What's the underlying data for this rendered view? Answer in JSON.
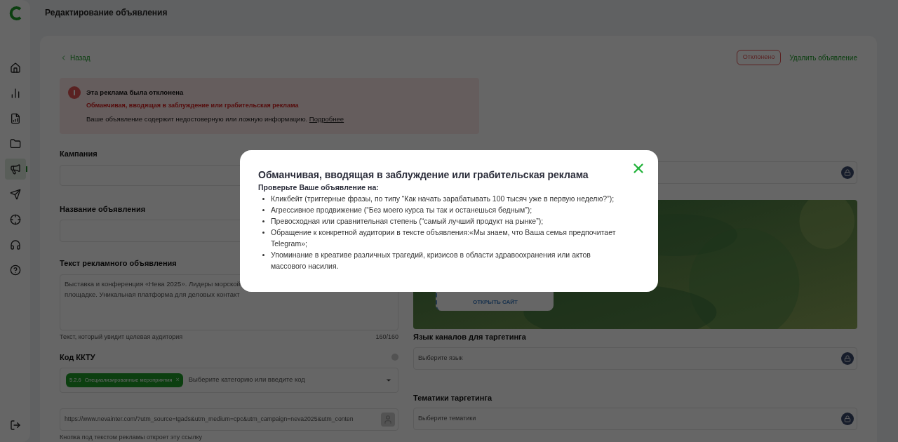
{
  "header": {
    "title": "Редактирование объявления"
  },
  "sidebar": {
    "items": [
      {
        "kind": "home",
        "selected": false
      },
      {
        "kind": "stats",
        "selected": false
      },
      {
        "kind": "report",
        "selected": false
      },
      {
        "kind": "folder",
        "selected": false
      },
      {
        "kind": "ads",
        "selected": true
      },
      {
        "kind": "send",
        "selected": false
      },
      {
        "kind": "target",
        "selected": false
      },
      {
        "kind": "support",
        "selected": false
      },
      {
        "kind": "help",
        "selected": false
      }
    ]
  },
  "back_link": "Назад",
  "status_badge": "Отклонено",
  "delete_link": "Удалить объявление",
  "alert": {
    "title": "Эта реклама была отклонена",
    "reason": "Обманчивая, вводящая в заблуждение или грабительская реклама",
    "message": "Ваше объявление содержит недостоверную или ложную информацию.",
    "link": "Подробнее"
  },
  "form": {
    "campaign_label": "Кампания",
    "name_label": "Название объявления",
    "text_label": "Текст рекламного объявления",
    "text_lines": [
      "Выставка и конференция «Нева 2025». Лидеры морской",
      "площадке. Уникальная платформа для деловых контакт"
    ],
    "text_hint": "Текст, который увидит целевая аудитория",
    "text_counter": "160/160",
    "code_label": "Код ККТУ",
    "code_tag": {
      "code": "5.2.6",
      "name": "Специализированные мероприятия",
      "remove": "×"
    },
    "code_placeholder": "Выберите категорию или введите код",
    "url": "https://www.nevainter.com/?utm_source=tgads&utm_medium=cpc&utm_campaign=neva2025&utm_conten",
    "url_hint": "Кнопка под текстом рекламы откроет эту ссылку"
  },
  "preview": {
    "button": "ОТКРЫТЬ САЙТ"
  },
  "targeting": {
    "language_label": "Язык каналов для таргетинга",
    "language_placeholder": "Выберите язык",
    "topics_label": "Тематики таргетинга",
    "topics_placeholder": "Выберите тематики"
  },
  "modal": {
    "title": "Обманчивая, вводящая в заблуждение или грабительская реклама",
    "subtitle": "Проверьте Ваше объявление на:",
    "items": [
      "Кликбейт (триггерные фразы, по типу “Как начать зарабатывать 100 тысяч уже в первую неделю?”);",
      "Агрессивное продвижение (“Без моего курса ты так и останешься бедным”);",
      "Превосходная или сравнительная степень (“самый лучший продукт на рынке”);",
      "Обращение к конкретной аудитории в тексте объявления:«Мы знаем, что Ваша семья предпочитает Telegram»;",
      "Упоминание в креативе различных трагедий, кризисов в области здравоохранения или актов массового насилия."
    ]
  }
}
